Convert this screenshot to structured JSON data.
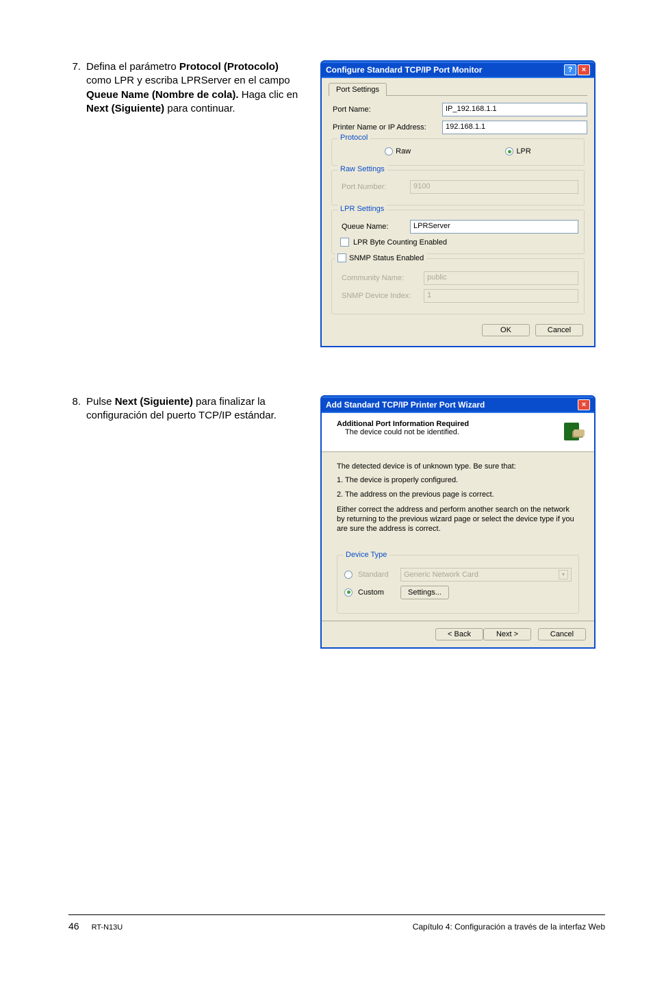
{
  "steps": {
    "s7": {
      "num": "7.",
      "t1": "Defina el parámetro ",
      "t2": "Protocol (Protocolo)",
      "t3": " como LPR y escriba LPRServer en el campo ",
      "t4": "Queue Name (Nombre de cola).",
      "t5": " Haga clic en ",
      "t6": "Next (Siguiente)",
      "t7": " para continuar."
    },
    "s8": {
      "num": "8.",
      "t1": "Pulse ",
      "t2": "Next (Siguiente)",
      "t3": " para finalizar la configuración del puerto TCP/IP estándar."
    }
  },
  "dialog1": {
    "title": "Configure Standard TCP/IP Port Monitor",
    "tab": "Port Settings",
    "portName_label": "Port Name:",
    "portName_value": "IP_192.168.1.1",
    "printerAddr_label": "Printer Name or IP Address:",
    "printerAddr_value": "192.168.1.1",
    "protocol_title": "Protocol",
    "raw_label": "Raw",
    "lpr_label": "LPR",
    "rawSettings_title": "Raw Settings",
    "portNumber_label": "Port Number:",
    "portNumber_value": "9100",
    "lprSettings_title": "LPR Settings",
    "queueName_label": "Queue Name:",
    "queueName_value": "LPRServer",
    "lprByteCounting": "LPR Byte Counting Enabled",
    "snmp_title": "SNMP Status Enabled",
    "community_label": "Community Name:",
    "community_value": "public",
    "snmpIndex_label": "SNMP Device Index:",
    "snmpIndex_value": "1",
    "ok": "OK",
    "cancel": "Cancel"
  },
  "dialog2": {
    "title": "Add Standard TCP/IP Printer Port Wizard",
    "header_title": "Additional Port Information Required",
    "header_sub": "The device could not be identified.",
    "para1": "The detected device is of unknown type. Be sure that:",
    "li1": "1.  The device is properly configured.",
    "li2": "2.  The address on the previous page is correct.",
    "para2": "Either correct the address and perform another search on the network by returning to the previous wizard page or select the device type if you are sure the address is correct.",
    "deviceType_title": "Device Type",
    "standard_label": "Standard",
    "standard_value": "Generic Network Card",
    "custom_label": "Custom",
    "settings_btn": "Settings...",
    "back": "< Back",
    "next": "Next >",
    "cancel": "Cancel"
  },
  "footer": {
    "page": "46",
    "model": "RT-N13U",
    "chapter": "Capítulo 4: Configuración a través de la interfaz Web"
  }
}
